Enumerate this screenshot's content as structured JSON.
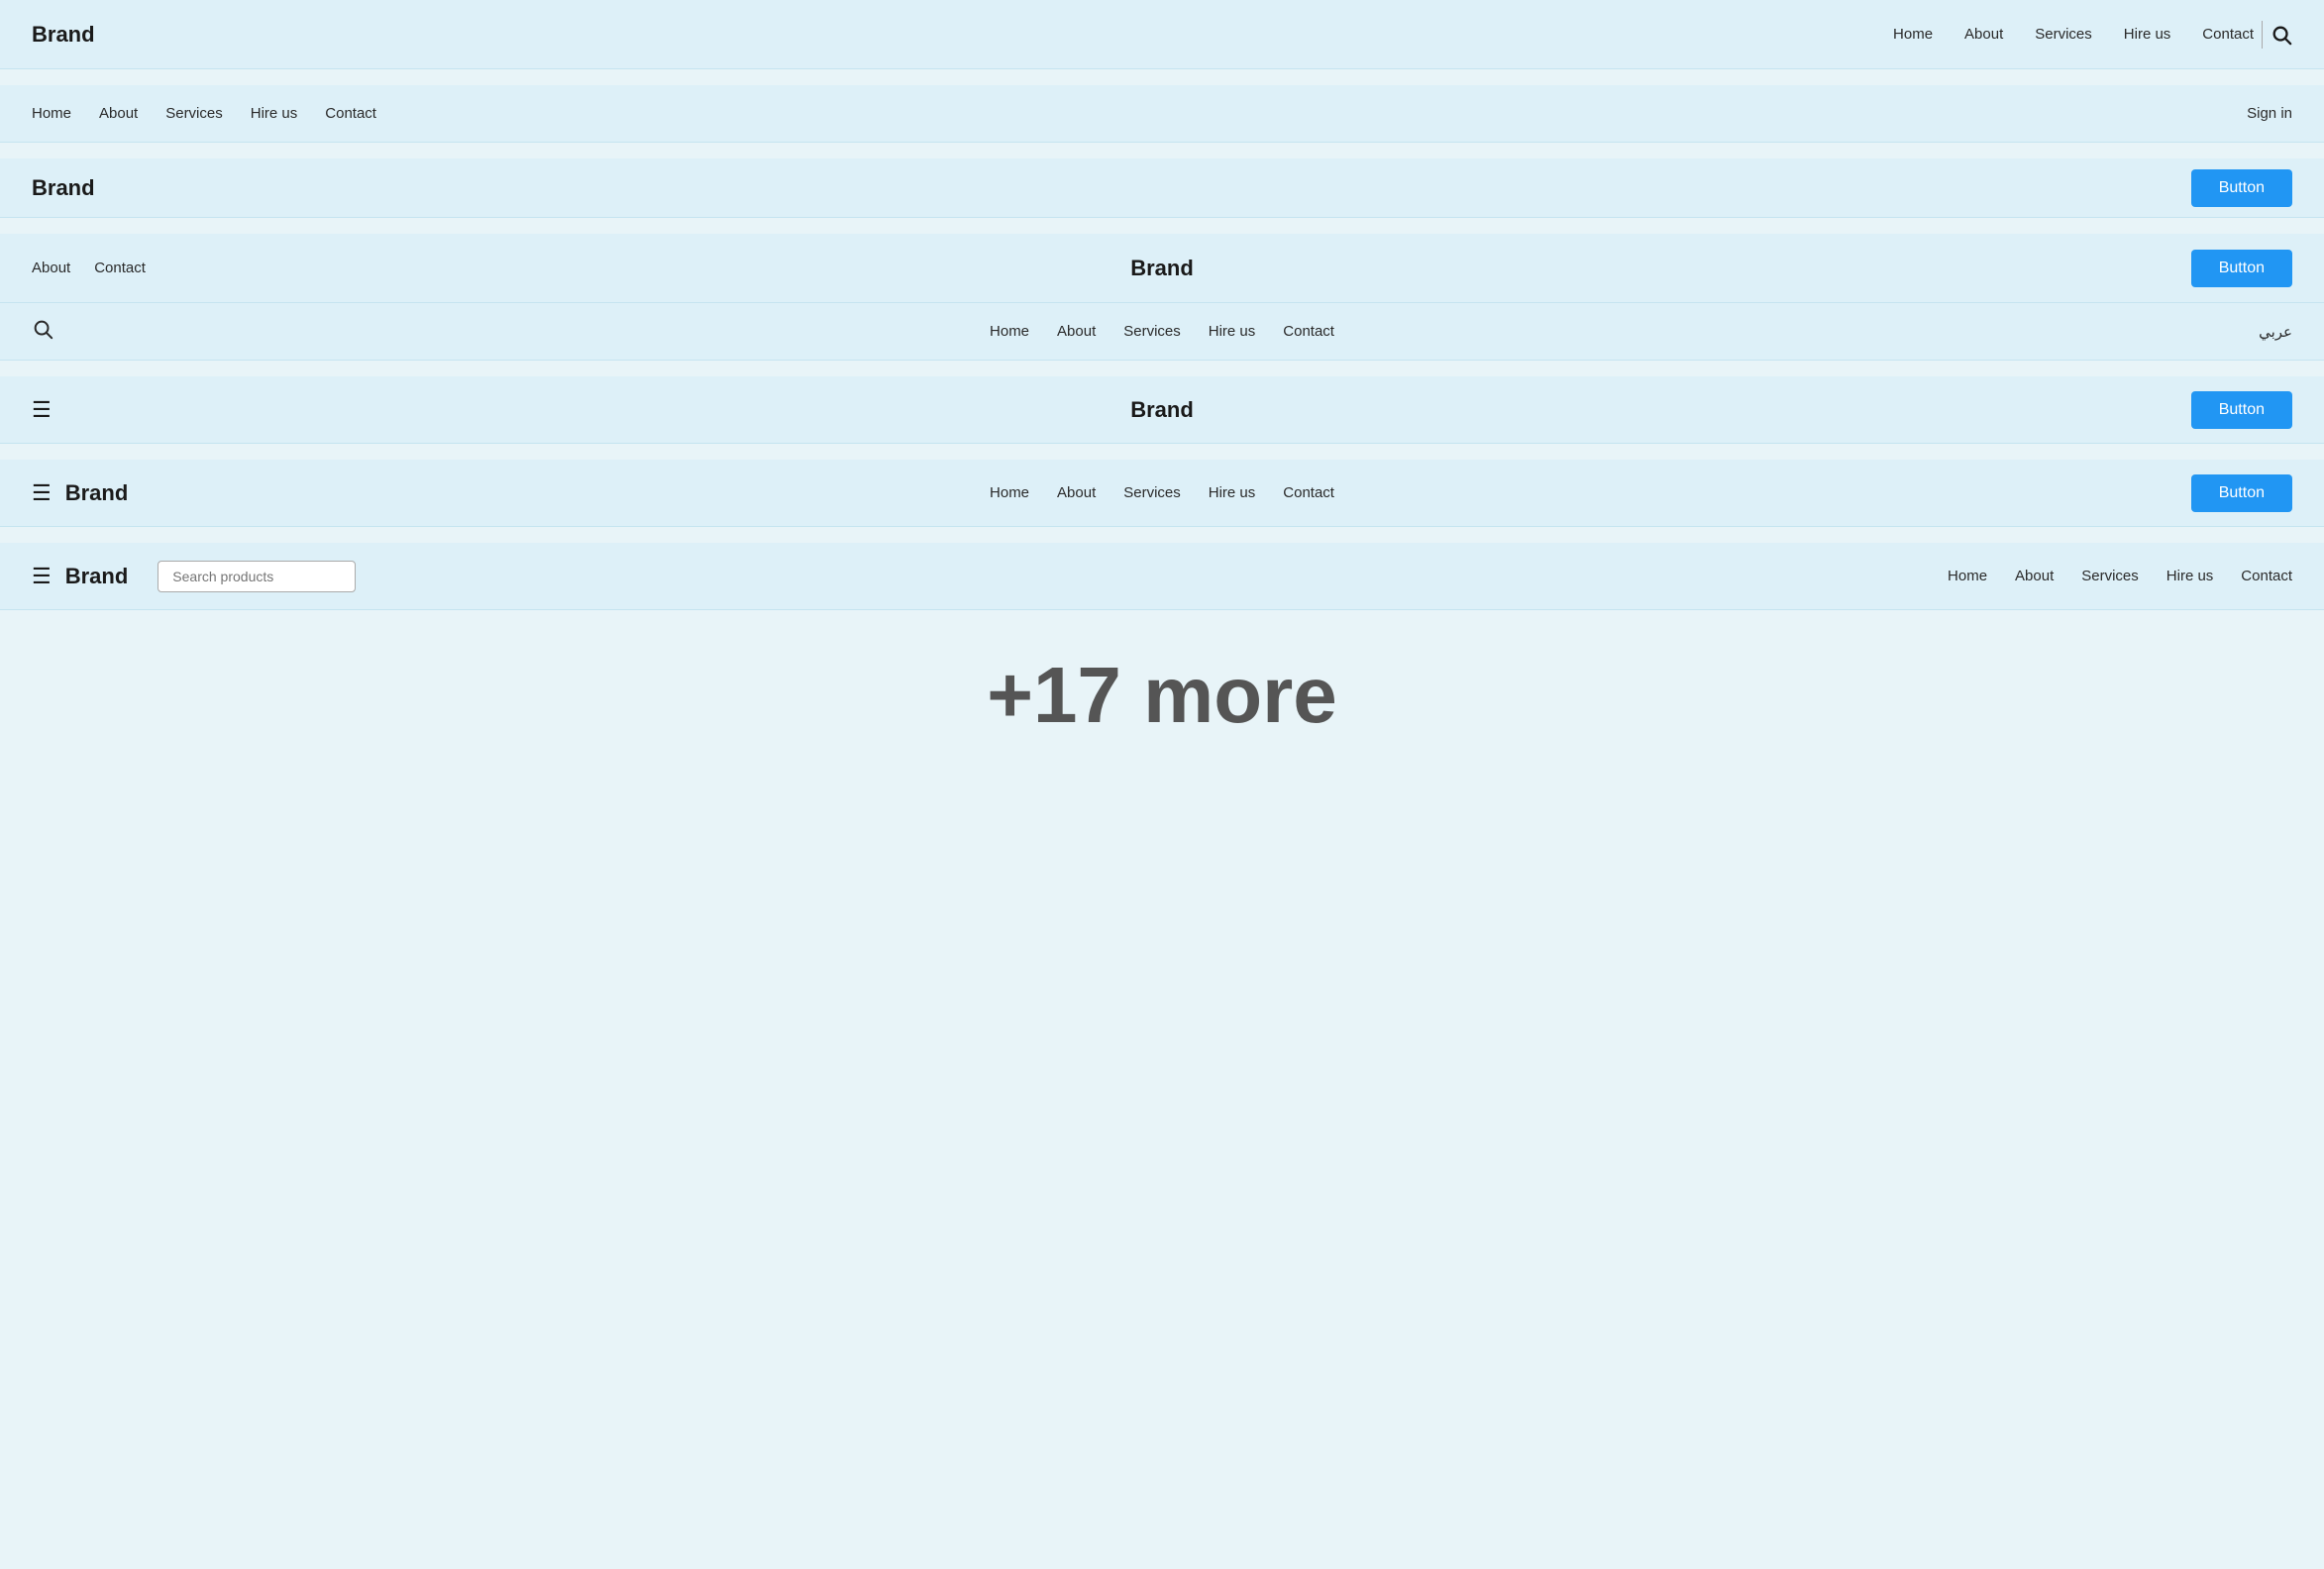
{
  "nav1": {
    "brand": "Brand",
    "links": [
      "Home",
      "About",
      "Services",
      "Hire us",
      "Contact"
    ],
    "search_icon": "🔍"
  },
  "nav2": {
    "links": [
      "Home",
      "About",
      "Services",
      "Hire us",
      "Contact"
    ],
    "signin": "Sign in"
  },
  "nav3": {
    "brand": "Brand",
    "button": "Button"
  },
  "nav4": {
    "left_links": [
      "About",
      "Contact"
    ],
    "brand": "Brand",
    "button": "Button"
  },
  "nav5": {
    "links": [
      "Home",
      "About",
      "Services",
      "Hire us",
      "Contact"
    ],
    "arabic": "عربي"
  },
  "nav6": {
    "brand": "Brand",
    "button": "Button"
  },
  "nav7": {
    "brand": "Brand",
    "links": [
      "Home",
      "About",
      "Services",
      "Hire us",
      "Contact"
    ],
    "button": "Button"
  },
  "nav8": {
    "brand": "Brand",
    "search_placeholder": "Search products",
    "links": [
      "Home",
      "About",
      "Services",
      "Hire us",
      "Contact"
    ]
  },
  "more": {
    "label": "+17 more"
  }
}
